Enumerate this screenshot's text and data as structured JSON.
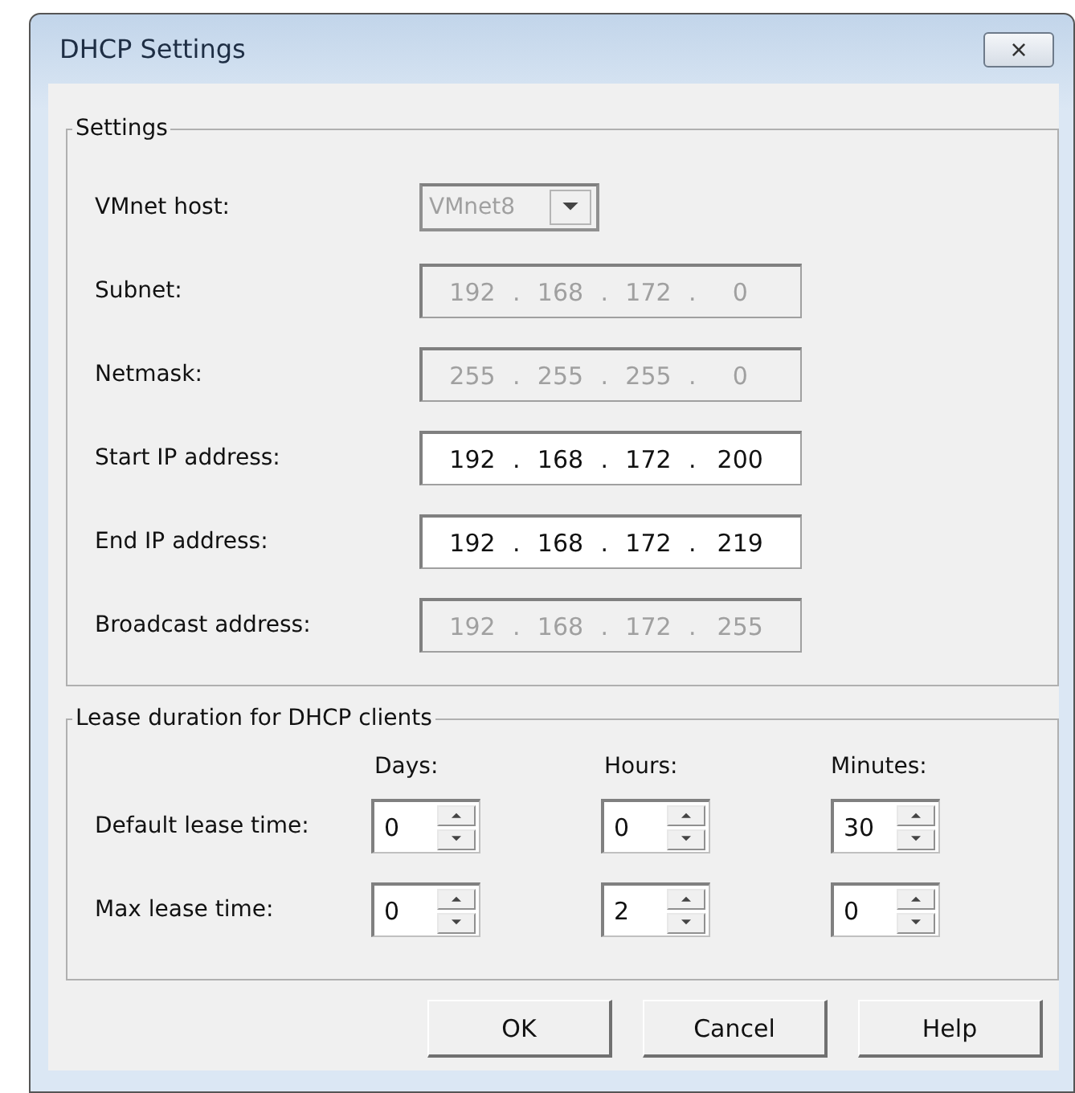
{
  "window": {
    "title": "DHCP Settings",
    "close": "×"
  },
  "settings": {
    "title": "Settings",
    "rows": [
      {
        "kind": "dropdown",
        "label": "VMnet host:",
        "value": "VMnet8",
        "disabled": true
      },
      {
        "kind": "ip",
        "label": "Subnet:",
        "octets": [
          "192",
          "168",
          "172",
          "0"
        ],
        "separator": ".",
        "disabled": true
      },
      {
        "kind": "ip",
        "label": "Netmask:",
        "octets": [
          "255",
          "255",
          "255",
          "0"
        ],
        "separator": ".",
        "disabled": true
      },
      {
        "kind": "ip",
        "label": "Start IP address:",
        "octets": [
          "192",
          "168",
          "172",
          "200"
        ],
        "separator": ".",
        "disabled": false
      },
      {
        "kind": "ip",
        "label": "End IP address:",
        "octets": [
          "192",
          "168",
          "172",
          "219"
        ],
        "separator": ".",
        "disabled": false
      },
      {
        "kind": "ip",
        "label": "Broadcast address:",
        "octets": [
          "192",
          "168",
          "172",
          "255"
        ],
        "separator": ".",
        "disabled": true
      }
    ]
  },
  "lease": {
    "title": "Lease duration for DHCP clients",
    "columns": [
      "Days:",
      "Hours:",
      "Minutes:"
    ],
    "rows": [
      {
        "label": "Default lease time:",
        "values": [
          "0",
          "0",
          "30"
        ]
      },
      {
        "label": "Max lease time:",
        "values": [
          "0",
          "2",
          "0"
        ]
      }
    ]
  },
  "buttons": [
    "OK",
    "Cancel",
    "Help"
  ]
}
